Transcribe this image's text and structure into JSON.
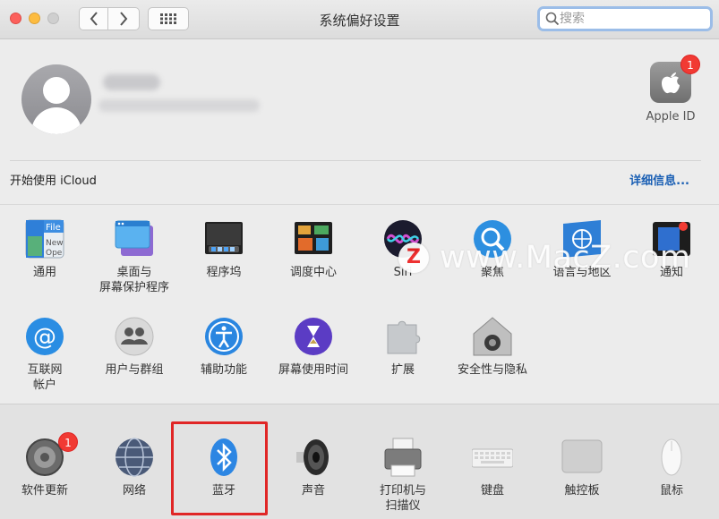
{
  "window": {
    "title": "系统偏好设置",
    "search_placeholder": "搜索"
  },
  "account": {
    "apple_id_label": "Apple ID",
    "apple_id_badge": "1",
    "icloud_text": "开始使用 iCloud",
    "details_link": "详细信息..."
  },
  "row1": [
    {
      "label": "通用",
      "icon": "general-icon"
    },
    {
      "label": "桌面与\n屏幕保护程序",
      "icon": "desktop-screensaver-icon"
    },
    {
      "label": "程序坞",
      "icon": "dock-icon"
    },
    {
      "label": "调度中心",
      "icon": "mission-control-icon"
    },
    {
      "label": "Siri",
      "icon": "siri-icon"
    },
    {
      "label": "聚焦",
      "icon": "spotlight-icon"
    },
    {
      "label": "语言与地区",
      "icon": "language-region-icon"
    },
    {
      "label": "通知",
      "icon": "notifications-icon"
    }
  ],
  "row2": [
    {
      "label": "互联网\n帐户",
      "icon": "internet-accounts-icon"
    },
    {
      "label": "用户与群组",
      "icon": "users-groups-icon"
    },
    {
      "label": "辅助功能",
      "icon": "accessibility-icon"
    },
    {
      "label": "屏幕使用时间",
      "icon": "screen-time-icon"
    },
    {
      "label": "扩展",
      "icon": "extensions-icon"
    },
    {
      "label": "安全性与隐私",
      "icon": "security-privacy-icon"
    }
  ],
  "row3": [
    {
      "label": "软件更新",
      "icon": "software-update-icon",
      "badge": "1"
    },
    {
      "label": "网络",
      "icon": "network-icon"
    },
    {
      "label": "蓝牙",
      "icon": "bluetooth-icon"
    },
    {
      "label": "声音",
      "icon": "sound-icon"
    },
    {
      "label": "打印机与\n扫描仪",
      "icon": "printers-scanners-icon"
    },
    {
      "label": "键盘",
      "icon": "keyboard-icon"
    },
    {
      "label": "触控板",
      "icon": "trackpad-icon"
    },
    {
      "label": "鼠标",
      "icon": "mouse-icon"
    }
  ],
  "watermark": {
    "logo_letter": "Z",
    "text": "www.MacZ.com"
  },
  "colors": {
    "highlight": "#e02626",
    "link": "#1a5fb4",
    "badge": "#f13a33"
  }
}
